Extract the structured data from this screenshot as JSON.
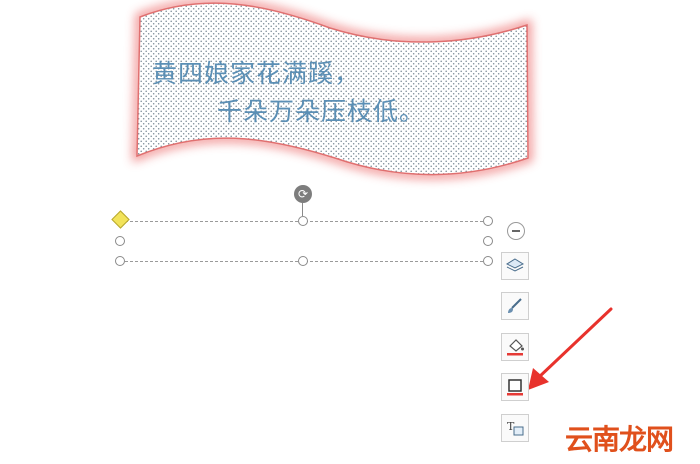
{
  "wordart": {
    "line1": "黄四娘家花满蹊，",
    "line2": "千朵万朵压枝低。",
    "text_color": "#5b8fb5",
    "fill": "dotted",
    "glow_color": "#f08a8a"
  },
  "toolbar": {
    "collapse": {
      "icon": "minus-circle-icon"
    },
    "buttons": [
      {
        "icon": "layers-icon"
      },
      {
        "icon": "brush-icon"
      },
      {
        "icon": "fill-bucket-icon"
      },
      {
        "icon": "shape-outline-icon",
        "highlighted": true
      },
      {
        "icon": "text-box-icon"
      }
    ]
  },
  "annotation": {
    "arrow_color": "#e8322c"
  },
  "watermark": {
    "text": "云南龙网",
    "color": "#e0501c"
  }
}
